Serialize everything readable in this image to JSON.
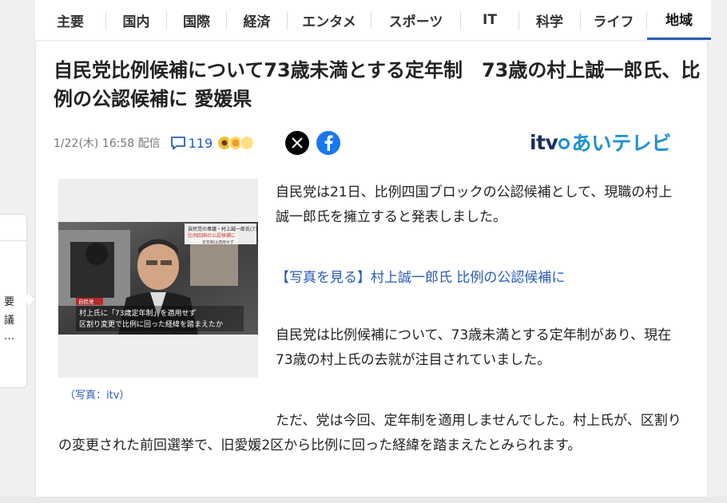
{
  "nav": {
    "items": [
      "主要",
      "国内",
      "国際",
      "経済",
      "エンタメ",
      "スポーツ",
      "IT",
      "科学",
      "ライフ",
      "地域"
    ],
    "active_index": 9
  },
  "side_card": {
    "lines": [
      "要",
      "議",
      "…"
    ]
  },
  "article": {
    "title": "自民党比例候補について73歳未満とする定年制　73歳の村上誠一郎氏、比例の公認候補に 愛媛県",
    "date": "1/22(木) 16:58 配信",
    "comment_count": "119",
    "brand_itv": "itv",
    "brand_name": "あいテレビ",
    "photo_caption": "（写真：itv）",
    "photo_overlay": {
      "top_line1": "自民党の衆議・村上誠一郎氏(73)",
      "top_line2": "比例四国の公認候補に",
      "top_line3": "定年制は適用せず",
      "party_tag": "自民党",
      "sub_line1": "村上氏に「73歳定年制」を適用せず",
      "sub_line2": "区割り変更で比例に回った経緯を踏まえたか"
    },
    "paragraphs": [
      "自民党は21日、比例四国ブロックの公認候補として、現職の村上誠一郎氏を擁立すると発表しました。",
      "自民党は比例候補について、73歳未満とする定年制があり、現在73歳の村上氏の去就が注目されていました。",
      "ただ、党は今回、定年制を適用しませんでした。村上氏が、区割りの変更された前回選挙で、旧愛媛2区から比例に回った経緯を踏まえたとみられます。"
    ],
    "photo_link": "【写真を見る】村上誠一郎氏 比例の公認候補に"
  },
  "colors": {
    "accent": "#2a5bb5",
    "brand_blue": "#1f8fd6",
    "x_black": "#000000",
    "facebook": "#1877f2"
  },
  "icons": [
    "comment-icon",
    "x-logo-icon",
    "facebook-icon"
  ]
}
